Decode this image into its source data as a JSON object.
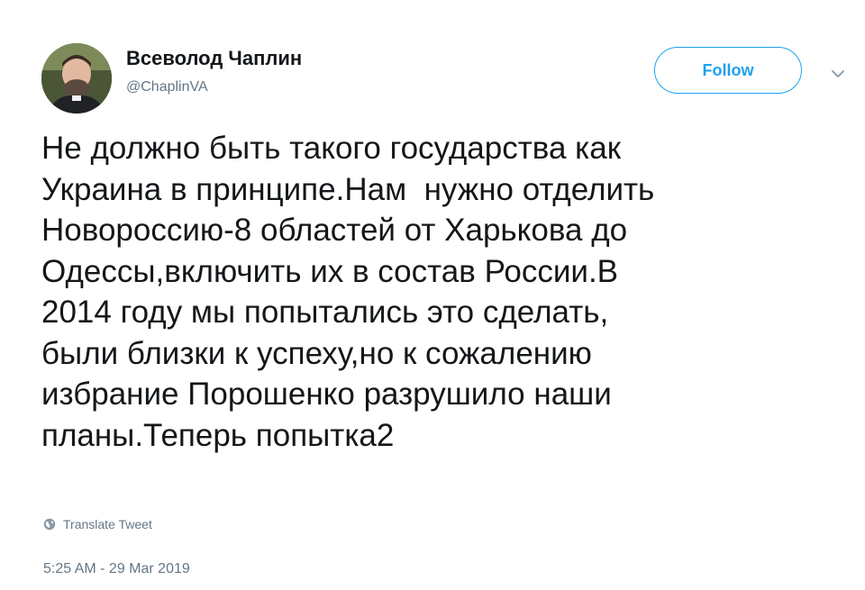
{
  "author": {
    "display_name": "Всеволод Чаплин",
    "handle": "@ChaplinVA"
  },
  "follow_label": "Follow",
  "tweet": {
    "lines": [
      "Не должно быть такого государства как",
      "Украина в принципе.Нам  нужно отделить",
      "Новороссию-8 областей от Харькова до",
      "Одессы,включить их в состав России.В",
      "2014 году мы попытались это сделать,",
      "были близки к успеху,но к сожалению",
      "избрание Порошенко разрушило наши",
      "планы.Теперь попытка2"
    ]
  },
  "translate_label": "Translate Tweet",
  "timestamp": "5:25 AM - 29 Mar 2019",
  "colors": {
    "accent": "#1da1f2",
    "text": "#14171a",
    "muted": "#657786"
  },
  "icons": {
    "caret": "chevron-down-icon",
    "translate": "globe-icon"
  }
}
